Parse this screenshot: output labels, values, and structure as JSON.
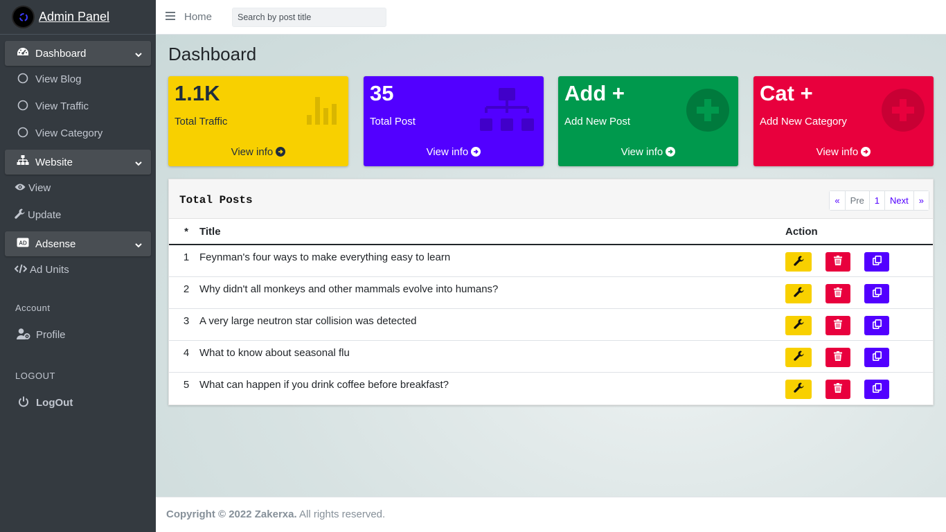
{
  "sidebar": {
    "brand": "Admin Panel",
    "groups": [
      {
        "label": "Dashboard",
        "icon": "tachometer-icon"
      },
      {
        "label": "Website",
        "icon": "sitemap-icon"
      },
      {
        "label": "Adsense",
        "icon": "ad-icon"
      }
    ],
    "dashboard_items": [
      "View Blog",
      "View Traffic",
      "View Category"
    ],
    "website_items": [
      "View",
      "Update"
    ],
    "adsense_items": [
      "Ad Units"
    ],
    "account_header": "Account",
    "account_items": [
      "Profile"
    ],
    "logout_header": "LOGOUT",
    "logout_label": "LogOut"
  },
  "header": {
    "home": "Home",
    "search_placeholder": "Search by post title"
  },
  "main": {
    "title": "Dashboard",
    "cards": [
      {
        "big": "1.1K",
        "small": "Total Traffic",
        "link": "View info",
        "color": "#f8d000",
        "icon": "bar-chart-icon"
      },
      {
        "big": "35",
        "small": "Total Post",
        "link": "View info",
        "color": "#5200ff",
        "icon": "sitemap-icon"
      },
      {
        "big": "Add +",
        "small": "Add New Post",
        "link": "View info",
        "color": "#00994d",
        "icon": "plus-circle-icon"
      },
      {
        "big": "Cat +",
        "small": "Add New Category",
        "link": "View info",
        "color": "#e8003d",
        "icon": "plus-circle-icon"
      }
    ],
    "table": {
      "title": "Total Posts",
      "pager": [
        "«",
        "Pre",
        "1",
        "Next",
        "»"
      ],
      "headers": [
        "*",
        "Title",
        "Action"
      ],
      "rows": [
        {
          "n": "1",
          "title": "Feynman's four ways to make everything easy to learn"
        },
        {
          "n": "2",
          "title": "Why didn't all monkeys and other mammals evolve into humans?"
        },
        {
          "n": "3",
          "title": "A very large neutron star collision was detected"
        },
        {
          "n": "4",
          "title": "What to know about seasonal flu"
        },
        {
          "n": "5",
          "title": "What can happen if you drink coffee before breakfast?"
        }
      ]
    }
  },
  "footer": {
    "copyright": "Copyright © 2022 Zakerxa.",
    "rights": " All rights reserved."
  }
}
